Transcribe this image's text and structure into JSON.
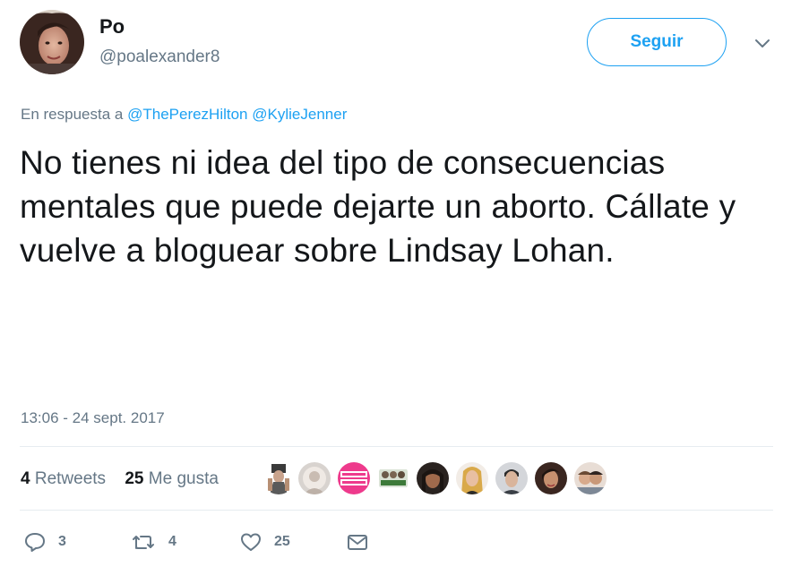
{
  "user": {
    "display_name": "Po",
    "handle": "@poalexander8"
  },
  "follow_button": {
    "label": "Seguir"
  },
  "reply_context": {
    "prefix": "En respuesta a",
    "mentions": [
      "@ThePerezHilton",
      "@KylieJenner"
    ]
  },
  "tweet": {
    "text": "No tienes ni idea del tipo de consecuencias mentales que puede dejarte un aborto. Cállate y vuelve a bloguear sobre Lindsay Lohan.",
    "timestamp": "13:06 - 24 sept. 2017"
  },
  "stats": {
    "retweets_count": "4",
    "retweets_label": "Retweets",
    "likes_count": "25",
    "likes_label": "Me gusta"
  },
  "likers": [
    {
      "icon": "liker-avatar"
    },
    {
      "icon": "liker-avatar"
    },
    {
      "icon": "perez-hilton-logo"
    },
    {
      "icon": "liker-avatar"
    },
    {
      "icon": "liker-avatar"
    },
    {
      "icon": "liker-avatar"
    },
    {
      "icon": "liker-avatar"
    },
    {
      "icon": "liker-avatar"
    },
    {
      "icon": "liker-avatar"
    }
  ],
  "actions": {
    "reply_count": "3",
    "retweet_count": "4",
    "like_count": "25"
  },
  "colors": {
    "accent": "#1da1f2",
    "text_primary": "#14171a",
    "text_secondary": "#657786",
    "divider": "#e6ecf0"
  }
}
